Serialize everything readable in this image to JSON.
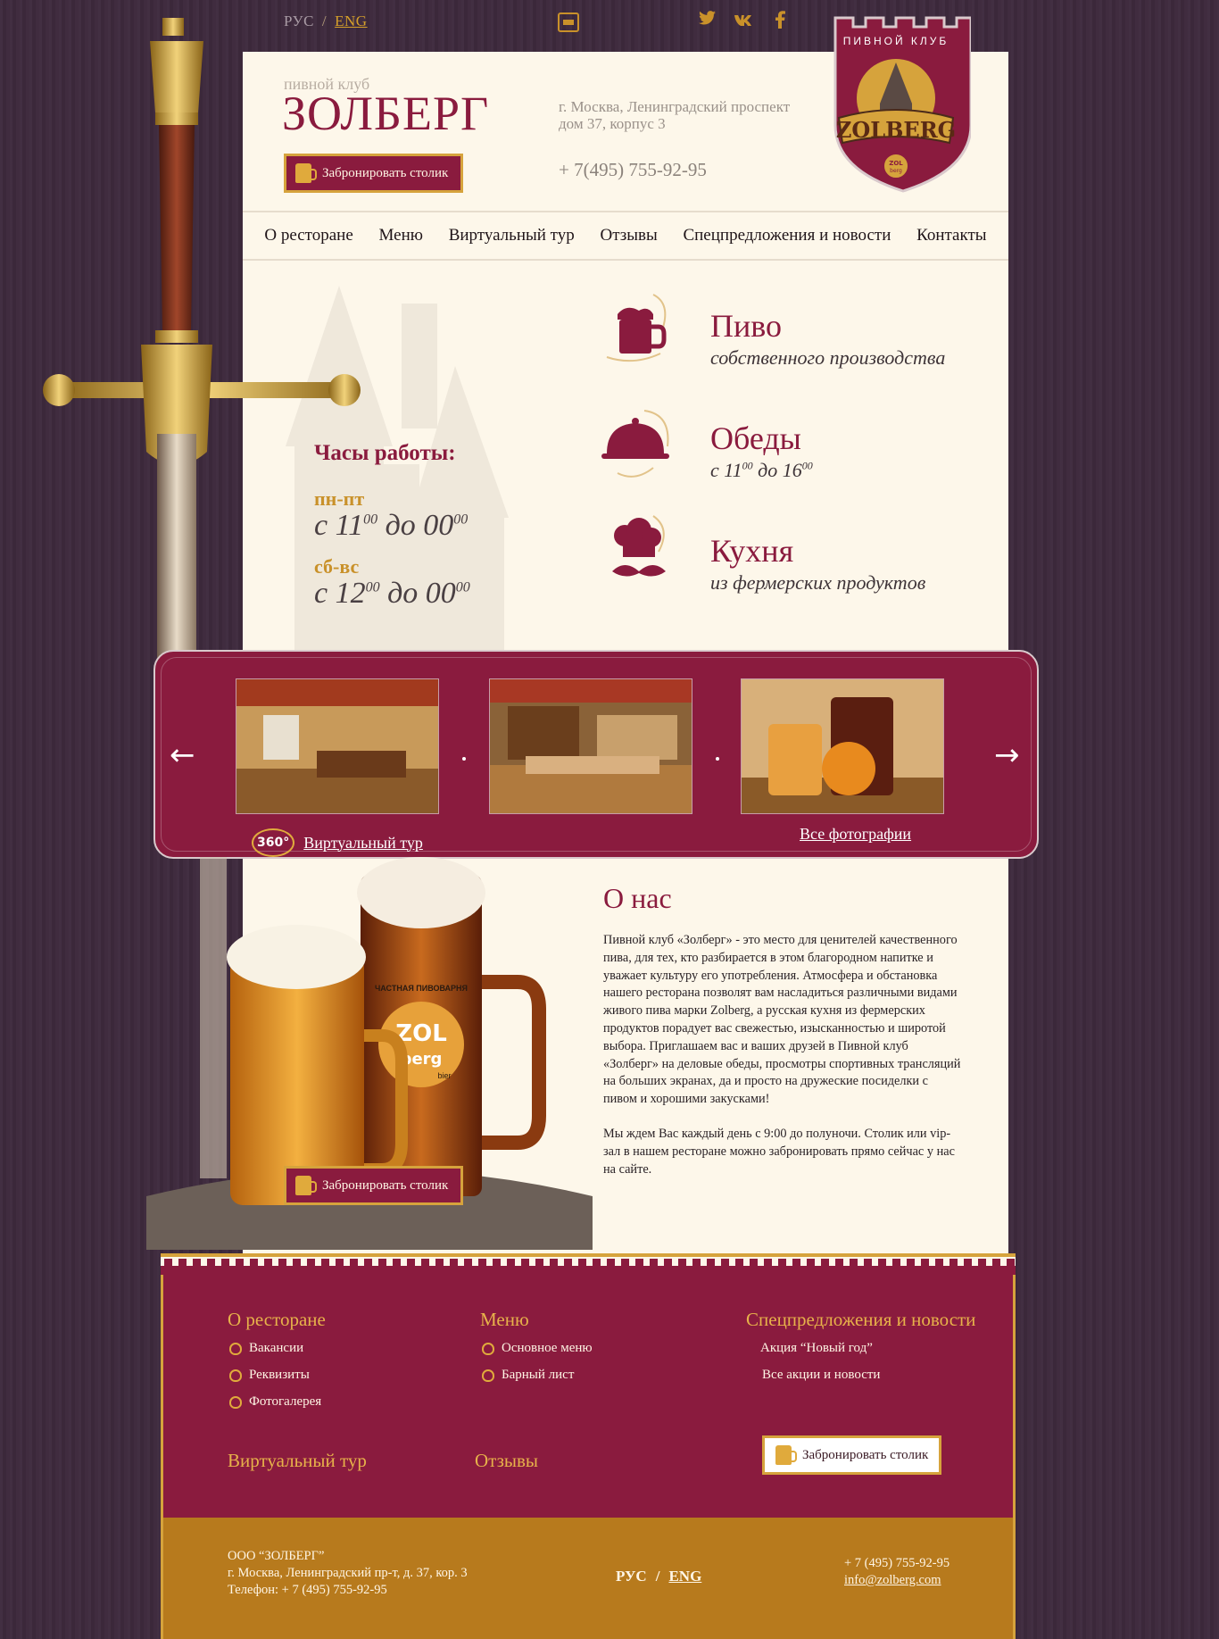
{
  "top": {
    "lang_ru": "РУС",
    "lang_sep": "/",
    "lang_en": "ENG",
    "social_icons": [
      "twitter-icon",
      "vk-icon",
      "facebook-icon"
    ]
  },
  "header": {
    "club_subtitle": "пивной клуб",
    "club_title": "ЗОЛБЕРГ",
    "book_label": "Забронировать столик",
    "address_line1": "г. Москва, Ленинградский проспект",
    "address_line2": "дом 37, корпус 3",
    "phone": "+ 7(495) 755-92-95"
  },
  "logo": {
    "arc_text": "ПИВНОЙ КЛУБ",
    "banner_text": "ZOLBERG",
    "badge_line1": "ZOL",
    "badge_line2": "berg"
  },
  "nav": [
    {
      "label": "О ресторане"
    },
    {
      "label": "Меню"
    },
    {
      "label": "Виртуальный тур"
    },
    {
      "label": "Отзывы"
    },
    {
      "label": "Спецпредложения и новости"
    },
    {
      "label": "Контакты"
    }
  ],
  "hours": {
    "title": "Часы работы:",
    "weekdays_label": "пн-пт",
    "weekdays_from": "с 11",
    "weekdays_from_min": "00",
    "weekdays_mid": " до  00",
    "weekdays_to_min": "00",
    "weekend_label": "сб-вс",
    "weekend_from": "с 12",
    "weekend_from_min": "00",
    "weekend_mid": " до  00",
    "weekend_to_min": "00"
  },
  "features": [
    {
      "title": "Пиво",
      "subtitle": "собственного производства",
      "icon": "beer-mug-icon"
    },
    {
      "title": "Обеды",
      "subtitle_a": "с 11",
      "sup_a": "00",
      "subtitle_b": " до 16",
      "sup_b": "00",
      "icon": "cloche-icon"
    },
    {
      "title": "Кухня",
      "subtitle": "из фермерских продуктов",
      "icon": "chef-icon"
    }
  ],
  "gallery": {
    "virtual_tour_badge": "360°",
    "virtual_tour_link": "Виртуальный тур",
    "all_photos_link": "Все фотографии"
  },
  "about": {
    "title": "О нас",
    "paragraph1": "Пивной клуб «Золберг» - это место для ценителей качественного пива, для тех, кто разбирается в этом благородном напитке и уважает культуру его употребления. Атмосфера и обстановка нашего ресторана позволят вам насладиться различными видами живого пива марки Zolberg, а русская кухня из фермерских продуктов порадует вас свежестью, изысканностью и широтой выбора. Приглашаем вас и ваших друзей в Пивной клуб «Золберг» на деловые обеды, просмотры спортивных трансляций на больших экранах, да и просто на дружеские посиделки с пивом и хорошими закусками!",
    "paragraph2": "Мы ждем Вас каждый день с 9:00 до полуночи. Столик или vip-зал в нашем ресторане можно забронировать прямо сейчас у нас на сайте.",
    "book_label": "Забронировать столик",
    "beer_label_top": "ЧАСТНАЯ ПИВОВАРНЯ",
    "beer_label_brand_top": "ZOL",
    "beer_label_brand_bottom": "berg",
    "beer_label_bier": "bier"
  },
  "footer": {
    "col1_title": "О ресторане",
    "col1_items": [
      "Вакансии",
      "Реквизиты",
      "Фотогалерея"
    ],
    "col2_title": "Меню",
    "col2_items": [
      "Основное меню",
      "Барный лист"
    ],
    "col3_title": "Спецпредложения и новости",
    "col3_items": [
      "Акция “Новый год”",
      "Все акции и новости"
    ],
    "virtual_tour": "Виртуальный тур",
    "reviews": "Отзывы",
    "book_label": "Забронировать столик",
    "company": "ООО “ЗОЛБЕРГ”",
    "company_address": "г. Москва, Ленинградский пр-т, д. 37, кор. 3",
    "company_phone": "Телефон: + 7 (495) 755-92-95",
    "lang_ru": "РУС",
    "lang_sep": "/",
    "lang_en": "ENG",
    "phone": "+ 7 (495) 755-92-95",
    "email": "info@zolberg.com"
  },
  "colors": {
    "burgundy": "#8a1b3e",
    "gold": "#d6a33c",
    "cream": "#fdf7ea",
    "background": "#3e2a3d",
    "footer_gold": "#b77a1d"
  }
}
